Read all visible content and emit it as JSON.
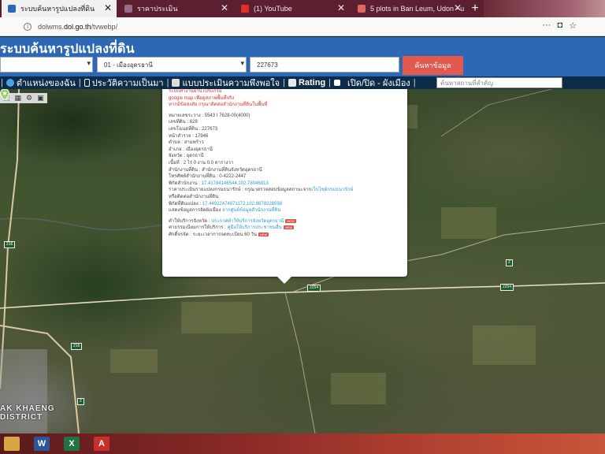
{
  "browser": {
    "tabs": [
      {
        "title": "ระบบค้นหารูปแปลงที่ดิน",
        "active": true,
        "favicon_color": "#2c68b3"
      },
      {
        "title": "ราคาประเมิน",
        "active": false,
        "favicon_color": "#9b6b8a"
      },
      {
        "title": "(1) YouTube",
        "active": false,
        "favicon_color": "#e52d27"
      },
      {
        "title": "5 plots in Ban Leum, Udon - u",
        "active": false,
        "favicon_color": "#d66"
      }
    ],
    "new_tab": "+",
    "url_prefix": "dolwms.",
    "url_domain": "dol.go.th",
    "url_path": "/tvwebp/",
    "menu_glyph": "···"
  },
  "site": {
    "title": "ระบบค้นหารูปแปลงที่ดิน",
    "province_select": "",
    "district_select": "01 - เมืองอุดรธานี",
    "parcel_input": "227673",
    "search_button": "ค้นหาข้อมูล"
  },
  "menu": {
    "items": [
      {
        "label": "ตำแหน่งของฉัน",
        "icon": "globe-icon",
        "color": "#4aa3df"
      },
      {
        "label": "ประวัติความเป็นมา",
        "icon": "history-icon",
        "color": "#ffffff"
      },
      {
        "label": "แบบประเมินความพึงพอใจ",
        "icon": "form-icon",
        "color": "#dddddd"
      },
      {
        "label": "Rating",
        "icon": "chart-icon",
        "color": "#e8e8e8"
      },
      {
        "label": "เปิด/ปิด - ผังเมือง",
        "icon": "layer-icon",
        "color": "#ffffff"
      }
    ],
    "place_placeholder": "ค้นหาสถานที่สำคัญ"
  },
  "map": {
    "district_label_1": "AK KHAENG",
    "district_label_2": "DISTRICT",
    "shields": [
      "216",
      "216",
      "2",
      "2254",
      "2254",
      "2"
    ]
  },
  "popup": {
    "top1": "ระบบทำงานผ่านโปรแกรม",
    "top2": "google map เพื่อดูสภาพพื้นที่จริง",
    "top3": "หากมีข้อสงสัย กรุณาติดต่อสำนักงานที่ดินในพื้นที่",
    "fields": [
      "หมายเลขระวาง : 5543 I 7628-00(4000)",
      "เลขที่ดิน : 628",
      "เลขโฉนดที่ดิน : 227673",
      "หน้าสำรวจ : 17946",
      "ตำบล : สามพร้าว",
      "อำเภอ : เมืองอุดรธานี",
      "จังหวัด : อุดรธานี",
      "เนื้อที่ : 2 ไร่ 0 งาน 0.0 ตารางวา",
      "สำนักงานที่ดิน : สำนักงานที่ดินจังหวัดอุดรธานี",
      "โทรศัพท์สำนักงานที่ดิน : 0-4222-2447"
    ],
    "office_coord_label": "พิกัดสำนักงาน : ",
    "office_coord_value": "17.41784146544,102.78046813",
    "appraisal_label": "ราคาประเมินรายแปลงกรมธนารักษ์ : กรุณาตรวจสอบข้อมูลสถานะจาก",
    "appraisal_link": "เว็บไซต์กรมธนารักษ์",
    "appraisal_tail": "หรือติดต่อสำนักงานที่ดิน",
    "parcel_coord_label": "พิกัดที่ดินแปลง : ",
    "parcel_coord_value": "17.44922474871172,102.8878228598",
    "plan_label": "แสดงข้อมูลการจัดผังเมือง ",
    "plan_link": "จากศูนย์ข้อมูลสำนักงานที่ดิน",
    "services": [
      {
        "label": "คำให้บริการจังหวัด : ",
        "link": "ประกาศคำให้บริการจังหวัดอุดรธานี",
        "badge": "NEW"
      },
      {
        "label": "ค่าธรรมเนียมการให้บริการ : ",
        "link": "คู่มือให้บริการประชาชนอื่น",
        "badge": "NEW"
      },
      {
        "label": "ศักดิ์จรจัด : ",
        "link": "ระยะเวลาการจดทะเบียน 60 วัน",
        "badge": "NEW"
      }
    ]
  },
  "taskbar": {
    "apps": [
      {
        "name": "windows-explorer-icon",
        "letter": "",
        "color": "#d9a441"
      },
      {
        "name": "word-icon",
        "letter": "W",
        "color": "#2b579a"
      },
      {
        "name": "excel-icon",
        "letter": "X",
        "color": "#217346"
      },
      {
        "name": "pdf-icon",
        "letter": "A",
        "color": "#c8302b"
      }
    ]
  }
}
